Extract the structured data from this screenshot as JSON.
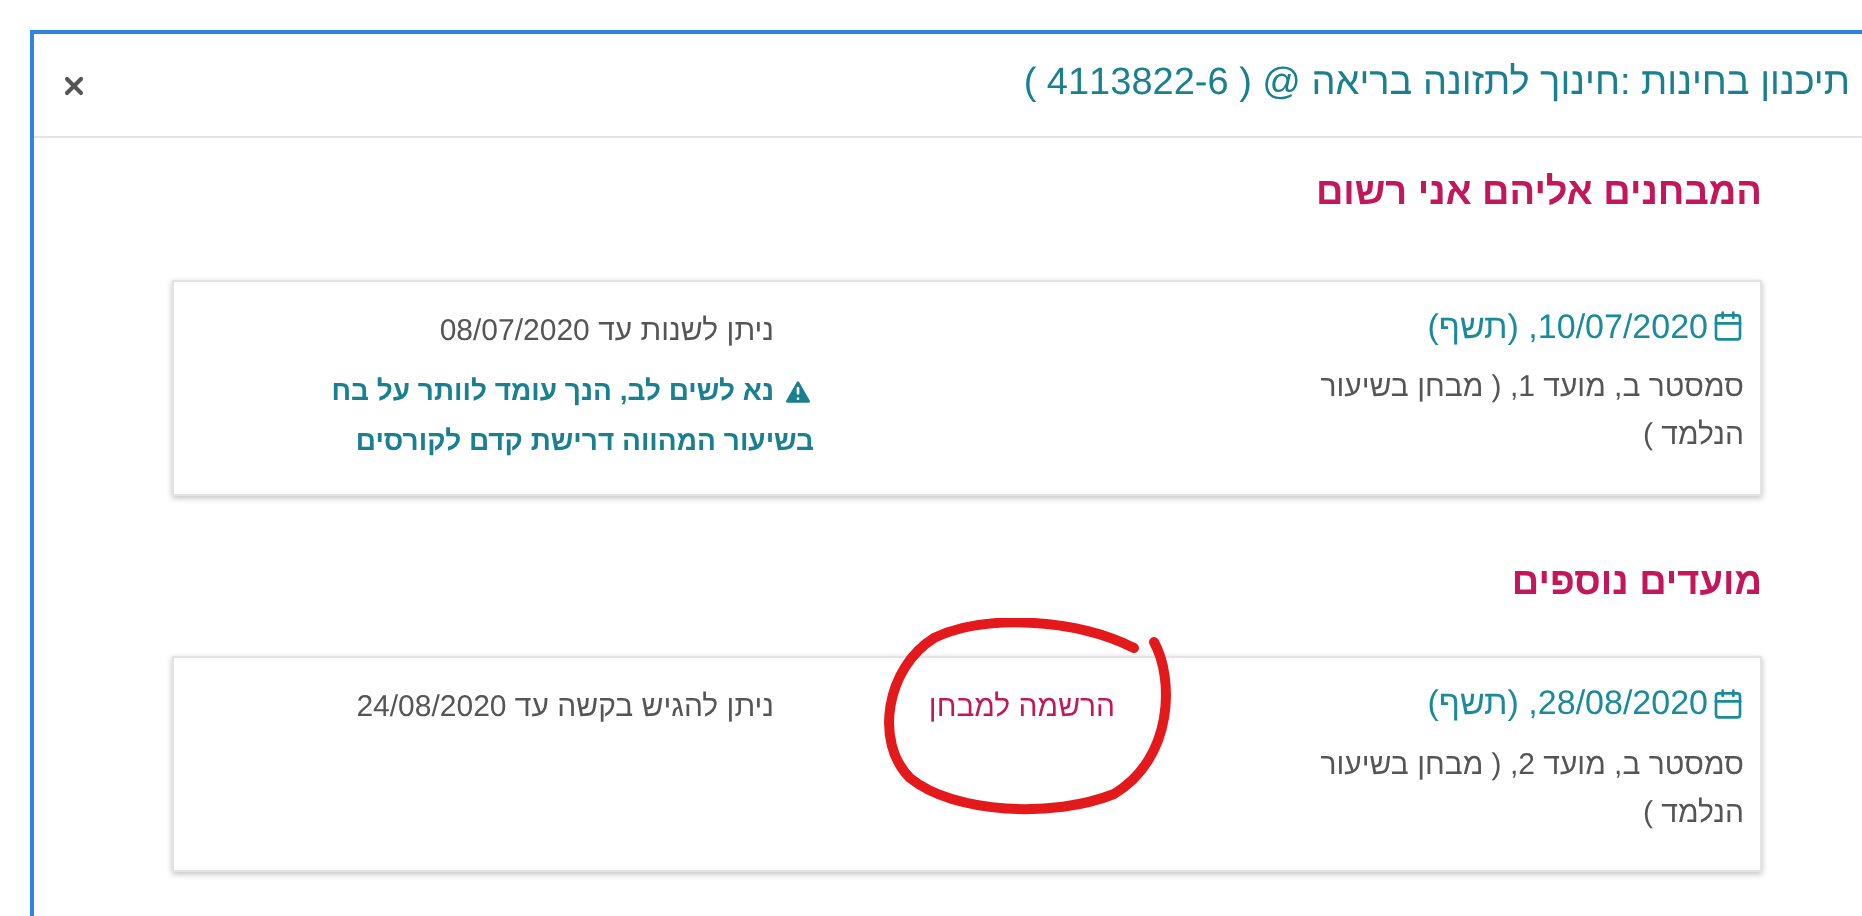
{
  "window": {
    "title": "תיכנון בחינות :חינוך לתזונה בריאה @ ( 4113822-6 )"
  },
  "sections": [
    {
      "heading": "המבחנים אליהם אני רשום",
      "exams": [
        {
          "date": "10/07/2020, (תשף)",
          "description": "סמסטר  ב, מועד  1, ( מבחן בשיעור הנלמד )",
          "note": "ניתן לשנות עד 08/07/2020",
          "warning": [
            "נא לשים לב, הנך עומד לוותר על בח",
            "בשיעור המהווה דרישת קדם לקורסים"
          ]
        }
      ]
    },
    {
      "heading": "מועדים נוספים",
      "exams": [
        {
          "date": "28/08/2020, (תשף)",
          "description": "סמסטר  ב, מועד  2, ( מבחן בשיעור הנלמד )",
          "note": "ניתן להגיש בקשה עד 24/08/2020",
          "register_link": "הרשמה למבחן",
          "circled": true
        }
      ]
    }
  ]
}
